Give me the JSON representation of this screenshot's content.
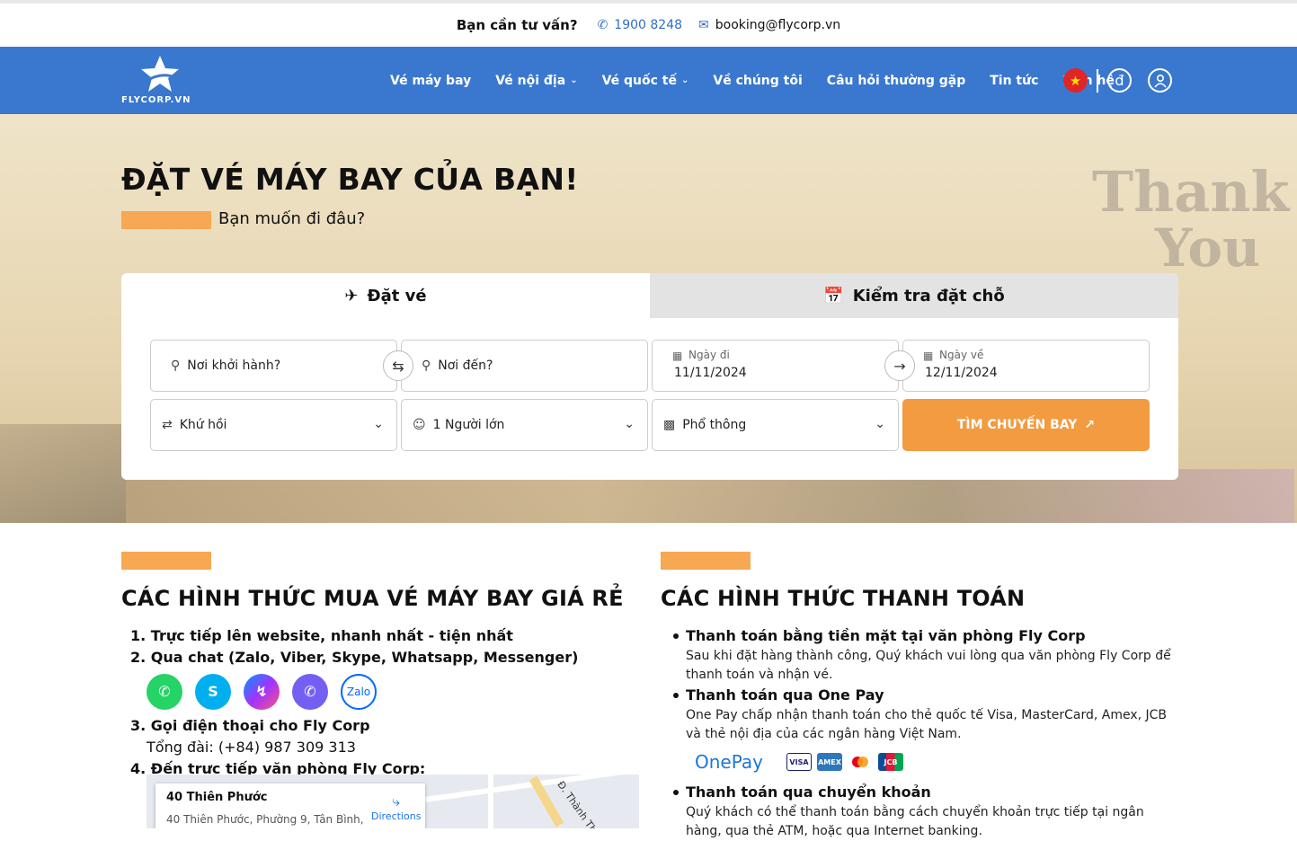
{
  "topbar": {
    "prompt": "Bạn cần tư vấn?",
    "phone": "1900 8248",
    "email": "booking@flycorp.vn"
  },
  "nav": {
    "logo_text": "FLYCORP.VN",
    "items": [
      {
        "label": "Vé máy bay",
        "dropdown": false
      },
      {
        "label": "Vé nội địa",
        "dropdown": true
      },
      {
        "label": "Vé quốc tế",
        "dropdown": true
      },
      {
        "label": "Về chúng tôi",
        "dropdown": false
      },
      {
        "label": "Câu hỏi thường gặp",
        "dropdown": false
      },
      {
        "label": "Tin tức",
        "dropdown": false
      },
      {
        "label": "Liên hệ",
        "dropdown": false
      }
    ],
    "currency_symbol": "đ"
  },
  "hero": {
    "title": "ĐẶT VÉ MÁY BAY CỦA BẠN!",
    "subtitle": "Bạn muốn đi đâu?",
    "deco_word1": "Thank",
    "deco_word2": "You"
  },
  "booking": {
    "tab_book": "Đặt vé",
    "tab_check": "Kiểm tra đặt chỗ",
    "origin_placeholder": "Nơi khởi hành?",
    "destination_placeholder": "Nơi đến?",
    "depart_label": "Ngày đi",
    "depart_value": "11/11/2024",
    "return_label": "Ngày về",
    "return_value": "12/11/2024",
    "trip_type": "Khứ hồi",
    "passengers": "1 Người lớn",
    "cabin_class": "Phổ thông",
    "search_label": "TÌM CHUYẾN BAY"
  },
  "buy_section": {
    "heading": "CÁC HÌNH THỨC MUA VÉ MÁY BAY GIÁ RẺ",
    "items": [
      "1. Trực tiếp lên website, nhanh nhất - tiện nhất",
      "2. Qua chat (Zalo, Viber, Skype, Whatsapp, Messenger)",
      "3. Gọi điện thoại cho Fly Corp",
      "4. Đến trực tiếp văn phòng Fly Corp:"
    ],
    "hotline": "Tổng đài: (+84) 987 309 313",
    "apps": [
      "whatsapp-icon",
      "skype-icon",
      "messenger-icon",
      "viber-icon",
      "zalo-icon"
    ],
    "zalo_text": "Zalo",
    "map": {
      "place": "40 Thiên Phước",
      "address": "40 Thiên Phước, Phường 9, Tân Bình,",
      "directions": "Directions",
      "street": "Đ. Thành Thái"
    }
  },
  "pay_section": {
    "heading": "CÁC HÌNH THỨC THANH TOÁN",
    "items": [
      {
        "title": "Thanh toán bằng tiền mặt tại văn phòng Fly Corp",
        "desc": "Sau khi đặt hàng thành công, Quý khách vui lòng qua văn phòng Fly Corp để thanh toán và nhận vé."
      },
      {
        "title": "Thanh toán qua One Pay",
        "desc": "One Pay chấp nhận thanh toán cho thẻ quốc tế Visa, MasterCard, Amex, JCB và thẻ nội địa của các ngân hàng Việt Nam."
      },
      {
        "title": "Thanh toán qua chuyển khoản",
        "desc": "Quý khách có thể thanh toán bằng cách chuyển khoản trực tiếp tại ngân hàng, qua thẻ ATM, hoặc qua Internet banking."
      }
    ],
    "onepay_logo": "OnePay",
    "cards": [
      "VISA",
      "AMEX",
      "MC",
      "JCB"
    ]
  },
  "colors": {
    "nav_bg": "#3a78cf",
    "accent": "#f29b40",
    "bar": "#f7a852"
  }
}
